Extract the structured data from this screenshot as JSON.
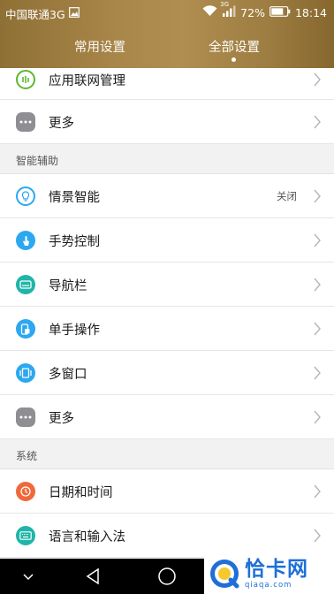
{
  "status_bar": {
    "carrier": "中国联通3G",
    "battery_percent": "72%",
    "time": "18:14",
    "network_badge": "3G"
  },
  "tabs": [
    {
      "label": "常用设置"
    },
    {
      "label": "全部设置"
    }
  ],
  "rows_top": [
    {
      "label": "应用联网管理",
      "icon": "network-app-icon",
      "color": "#5cb830"
    },
    {
      "label": "更多",
      "icon": "more-dots-icon",
      "color": "#8e8e93"
    }
  ],
  "sections": {
    "assist": "智能辅助",
    "system": "系统"
  },
  "rows_assist": [
    {
      "label": "情景智能",
      "value": "关闭",
      "icon": "bulb-icon",
      "color": "#2ba8f0"
    },
    {
      "label": "手势控制",
      "icon": "gesture-icon",
      "color": "#2ba8f0"
    },
    {
      "label": "导航栏",
      "icon": "navbar-icon",
      "color": "#1fb5a8"
    },
    {
      "label": "单手操作",
      "icon": "one-hand-icon",
      "color": "#2ba8f0"
    },
    {
      "label": "多窗口",
      "icon": "multi-window-icon",
      "color": "#2ba8f0"
    },
    {
      "label": "更多",
      "icon": "more-dots-icon",
      "color": "#8e8e93"
    }
  ],
  "rows_system": [
    {
      "label": "日期和时间",
      "icon": "clock-icon",
      "color": "#f0683a"
    },
    {
      "label": "语言和输入法",
      "icon": "keyboard-icon",
      "color": "#1fb5a8"
    }
  ],
  "watermark": {
    "title": "恰卡网",
    "subtitle": "qiaqa.com"
  }
}
